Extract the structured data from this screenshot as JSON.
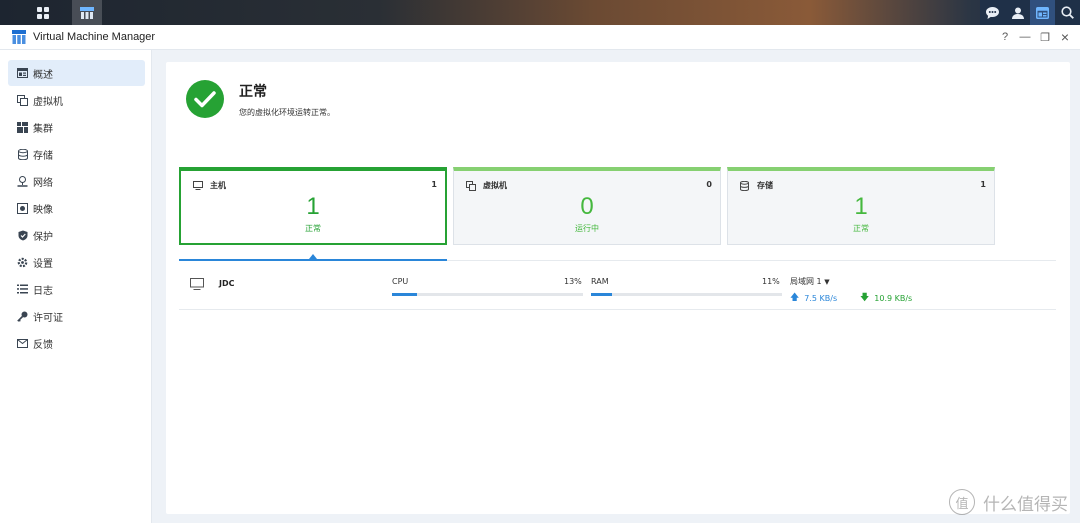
{
  "window": {
    "title": "Virtual Machine Manager",
    "help": "?",
    "minimize": "—",
    "restore": "❐",
    "close": "×"
  },
  "sidebar": {
    "items": [
      {
        "label": "概述",
        "icon": "overview-icon",
        "active": true
      },
      {
        "label": "虚拟机",
        "icon": "vm-icon"
      },
      {
        "label": "集群",
        "icon": "cluster-icon"
      },
      {
        "label": "存储",
        "icon": "storage-icon"
      },
      {
        "label": "网络",
        "icon": "network-icon"
      },
      {
        "label": "映像",
        "icon": "image-icon"
      },
      {
        "label": "保护",
        "icon": "protection-icon"
      },
      {
        "label": "设置",
        "icon": "settings-icon"
      },
      {
        "label": "日志",
        "icon": "log-icon"
      },
      {
        "label": "许可证",
        "icon": "license-icon"
      },
      {
        "label": "反馈",
        "icon": "feedback-icon"
      }
    ]
  },
  "status": {
    "title": "正常",
    "description": "您的虚拟化环境运转正常。",
    "color": "#26a234"
  },
  "cards": [
    {
      "label": "主机",
      "count": "1",
      "number": "1",
      "status": "正常",
      "selected": true
    },
    {
      "label": "虚拟机",
      "count": "0",
      "number": "0",
      "status": "运行中"
    },
    {
      "label": "存储",
      "count": "1",
      "number": "1",
      "status": "正常"
    }
  ],
  "host": {
    "name": "JDC",
    "cpu": {
      "label": "CPU",
      "percent_text": "13%",
      "value": 0.13
    },
    "ram": {
      "label": "RAM",
      "percent_text": "11%",
      "value": 0.11
    },
    "network": {
      "label": "局域网 1",
      "upload": "7.5 KB/s",
      "download": "10.9 KB/s"
    }
  },
  "watermark": {
    "text": "什么值得买",
    "logo_text": "值"
  },
  "colors": {
    "accent": "#2a86d9",
    "success": "#26a234",
    "card_top": "#86d071"
  }
}
